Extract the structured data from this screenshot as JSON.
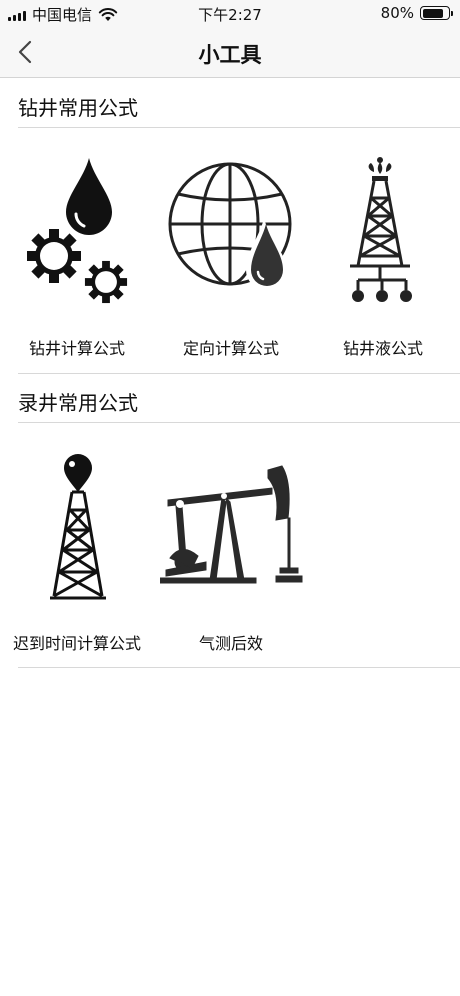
{
  "status_bar": {
    "carrier": "中国电信",
    "time": "下午2:27",
    "battery_level": "80%",
    "battery_fraction": 0.8
  },
  "nav": {
    "back_icon": "chevron-left-icon",
    "title": "小工具"
  },
  "sections": [
    {
      "title": "钻井常用公式",
      "items": [
        {
          "label": "钻井计算公式",
          "icon": "oil-drop-gears-icon"
        },
        {
          "label": "定向计算公式",
          "icon": "globe-oil-drop-icon"
        },
        {
          "label": "钻井液公式",
          "icon": "drilling-rig-icon"
        }
      ]
    },
    {
      "title": "录井常用公式",
      "items": [
        {
          "label": "迟到时间计算公式",
          "icon": "oil-derrick-icon"
        },
        {
          "label": "气测后效",
          "icon": "pumpjack-icon"
        }
      ]
    }
  ]
}
